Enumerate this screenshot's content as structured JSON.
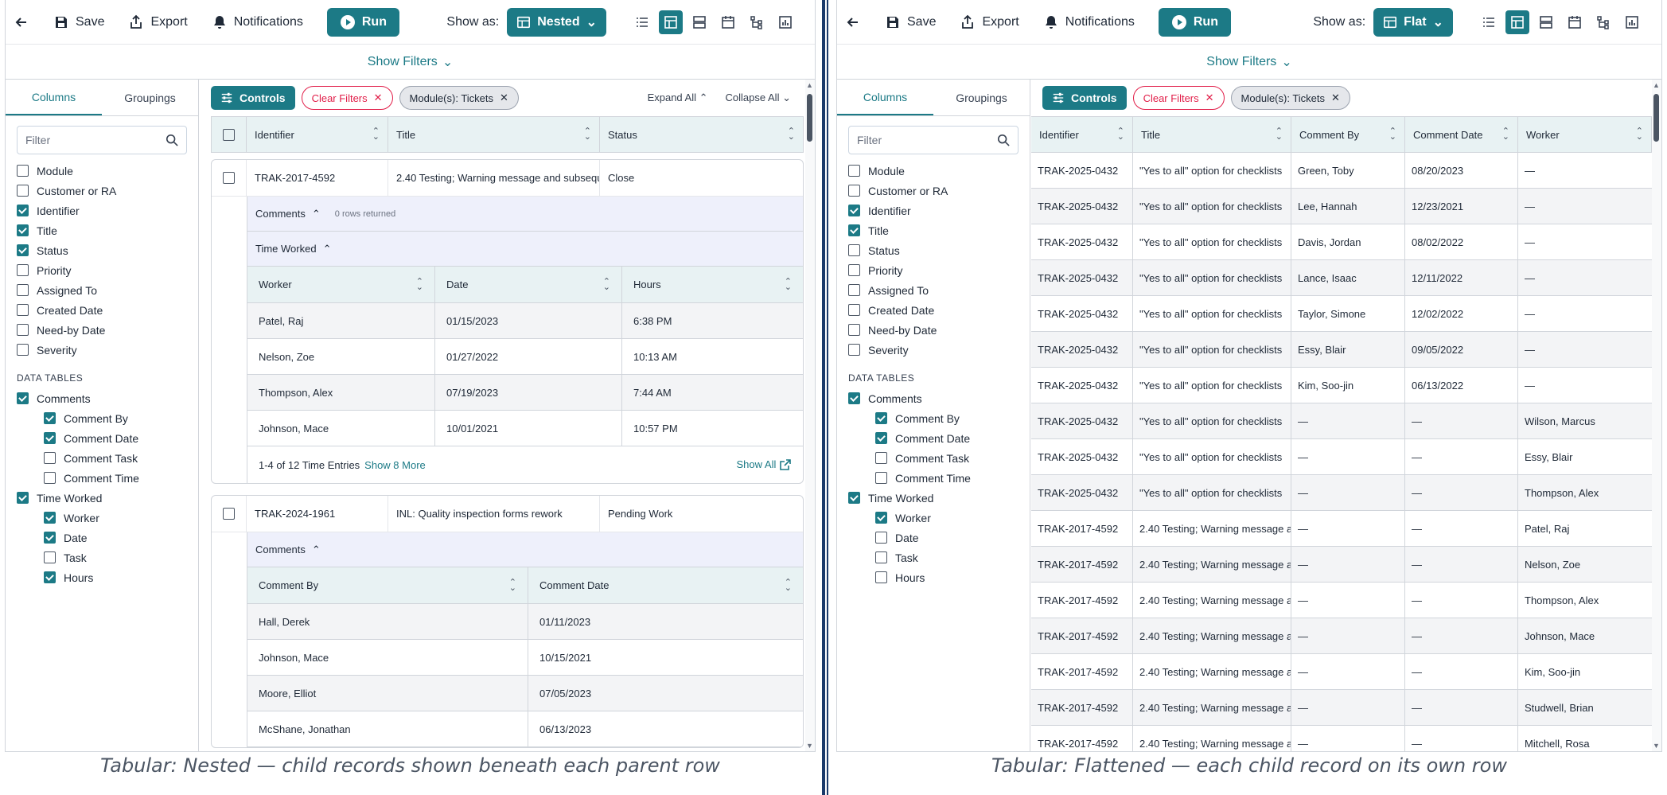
{
  "toolbar": {
    "save": "Save",
    "export": "Export",
    "notifications": "Notifications",
    "run": "Run",
    "show_as_label": "Show as:"
  },
  "show_filters": "Show Filters",
  "side": {
    "tab_columns": "Columns",
    "tab_groupings": "Groupings",
    "filter_placeholder": "Filter",
    "data_tables_heading": "DATA TABLES"
  },
  "controls": {
    "controls_btn": "Controls",
    "clear_filters": "Clear Filters",
    "module_chip": "Module(s): Tickets",
    "expand_all": "Expand All",
    "collapse_all": "Collapse All"
  },
  "left": {
    "show_as_value": "Nested",
    "caption": "Tabular: Nested — child records shown beneath each parent row",
    "columns": [
      {
        "label": "Module",
        "checked": false
      },
      {
        "label": "Customer or RA",
        "checked": false
      },
      {
        "label": "Identifier",
        "checked": true
      },
      {
        "label": "Title",
        "checked": true
      },
      {
        "label": "Status",
        "checked": true
      },
      {
        "label": "Priority",
        "checked": false
      },
      {
        "label": "Assigned To",
        "checked": false
      },
      {
        "label": "Created Date",
        "checked": false
      },
      {
        "label": "Need-by Date",
        "checked": false
      },
      {
        "label": "Severity",
        "checked": false
      }
    ],
    "data_tables": {
      "comments": {
        "label": "Comments",
        "checked": true,
        "children": [
          {
            "label": "Comment By",
            "checked": true
          },
          {
            "label": "Comment Date",
            "checked": true
          },
          {
            "label": "Comment Task",
            "checked": false
          },
          {
            "label": "Comment Time",
            "checked": false
          }
        ]
      },
      "time_worked": {
        "label": "Time Worked",
        "checked": true,
        "children": [
          {
            "label": "Worker",
            "checked": true
          },
          {
            "label": "Date",
            "checked": true
          },
          {
            "label": "Task",
            "checked": false
          },
          {
            "label": "Hours",
            "checked": true
          }
        ]
      }
    },
    "table_headers": [
      "Identifier",
      "Title",
      "Status"
    ],
    "cards": [
      {
        "identifier": "TRAK-2017-4592",
        "title": "2.40 Testing; Warning message and subsequ",
        "status": "Close",
        "comments_label": "Comments",
        "comments_note": "0 rows returned",
        "time_label": "Time Worked",
        "time_headers": [
          "Worker",
          "Date",
          "Hours"
        ],
        "time_rows": [
          [
            "Patel, Raj",
            "01/15/2023",
            "6:38 PM"
          ],
          [
            "Nelson, Zoe",
            "01/27/2022",
            "10:13 AM"
          ],
          [
            "Thompson, Alex",
            "07/19/2023",
            "7:44 AM"
          ],
          [
            "Johnson, Mace",
            "10/01/2021",
            "10:57 PM"
          ]
        ],
        "footer_count": "1-4 of 12 Time Entries",
        "footer_more": "Show 8 More",
        "footer_all": "Show All"
      },
      {
        "identifier": "TRAK-2024-1961",
        "title": "INL: Quality inspection forms rework",
        "status": "Pending Work",
        "comments_label": "Comments",
        "comment_headers": [
          "Comment By",
          "Comment Date"
        ],
        "comment_rows": [
          [
            "Hall, Derek",
            "01/11/2023"
          ],
          [
            "Johnson, Mace",
            "10/15/2021"
          ],
          [
            "Moore, Elliot",
            "07/05/2023"
          ],
          [
            "McShane, Jonathan",
            "06/13/2023"
          ]
        ]
      }
    ]
  },
  "right": {
    "show_as_value": "Flat",
    "caption": "Tabular: Flattened — each child record on its own row",
    "columns": [
      {
        "label": "Module",
        "checked": false
      },
      {
        "label": "Customer or RA",
        "checked": false
      },
      {
        "label": "Identifier",
        "checked": true
      },
      {
        "label": "Title",
        "checked": true
      },
      {
        "label": "Status",
        "checked": false
      },
      {
        "label": "Priority",
        "checked": false
      },
      {
        "label": "Assigned To",
        "checked": false
      },
      {
        "label": "Created Date",
        "checked": false
      },
      {
        "label": "Need-by Date",
        "checked": false
      },
      {
        "label": "Severity",
        "checked": false
      }
    ],
    "data_tables": {
      "comments": {
        "label": "Comments",
        "checked": true,
        "children": [
          {
            "label": "Comment By",
            "checked": true
          },
          {
            "label": "Comment Date",
            "checked": true
          },
          {
            "label": "Comment Task",
            "checked": false
          },
          {
            "label": "Comment Time",
            "checked": false
          }
        ]
      },
      "time_worked": {
        "label": "Time Worked",
        "checked": true,
        "children": [
          {
            "label": "Worker",
            "checked": true
          },
          {
            "label": "Date",
            "checked": false
          },
          {
            "label": "Task",
            "checked": false
          },
          {
            "label": "Hours",
            "checked": false
          }
        ]
      }
    },
    "table_headers": [
      "Identifier",
      "Title",
      "Comment By",
      "Comment Date",
      "Worker"
    ],
    "rows": [
      [
        "TRAK-2025-0432",
        "\"Yes to all\" option for checklists",
        "Green, Toby",
        "08/20/2023",
        "—"
      ],
      [
        "TRAK-2025-0432",
        "\"Yes to all\" option for checklists",
        "Lee, Hannah",
        "12/23/2021",
        "—"
      ],
      [
        "TRAK-2025-0432",
        "\"Yes to all\" option for checklists",
        "Davis, Jordan",
        "08/02/2022",
        "—"
      ],
      [
        "TRAK-2025-0432",
        "\"Yes to all\" option for checklists",
        "Lance, Isaac",
        "12/11/2022",
        "—"
      ],
      [
        "TRAK-2025-0432",
        "\"Yes to all\" option for checklists",
        "Taylor, Simone",
        "12/02/2022",
        "—"
      ],
      [
        "TRAK-2025-0432",
        "\"Yes to all\" option for checklists",
        "Essy, Blair",
        "09/05/2022",
        "—"
      ],
      [
        "TRAK-2025-0432",
        "\"Yes to all\" option for checklists",
        "Kim, Soo-jin",
        "06/13/2022",
        "—"
      ],
      [
        "TRAK-2025-0432",
        "\"Yes to all\" option for checklists",
        "—",
        "—",
        "Wilson, Marcus"
      ],
      [
        "TRAK-2025-0432",
        "\"Yes to all\" option for checklists",
        "—",
        "—",
        "Essy, Blair"
      ],
      [
        "TRAK-2025-0432",
        "\"Yes to all\" option for checklists",
        "—",
        "—",
        "Thompson, Alex"
      ],
      [
        "TRAK-2017-4592",
        "2.40 Testing; Warning message a",
        "—",
        "—",
        "Patel, Raj"
      ],
      [
        "TRAK-2017-4592",
        "2.40 Testing; Warning message a",
        "—",
        "—",
        "Nelson, Zoe"
      ],
      [
        "TRAK-2017-4592",
        "2.40 Testing; Warning message a",
        "—",
        "—",
        "Thompson, Alex"
      ],
      [
        "TRAK-2017-4592",
        "2.40 Testing; Warning message a",
        "—",
        "—",
        "Johnson, Mace"
      ],
      [
        "TRAK-2017-4592",
        "2.40 Testing; Warning message a",
        "—",
        "—",
        "Kim, Soo-jin"
      ],
      [
        "TRAK-2017-4592",
        "2.40 Testing; Warning message a",
        "—",
        "—",
        "Studwell, Brian"
      ],
      [
        "TRAK-2017-4592",
        "2.40 Testing; Warning message a",
        "—",
        "—",
        "Mitchell, Rosa"
      ]
    ]
  },
  "colors": {
    "accent": "#1c7a86",
    "danger": "#e11d48",
    "header_bg": "#e8f2f3",
    "sub_bg": "#eef0fb",
    "divider": "#1b3a6b"
  },
  "icons": [
    "back-arrow-icon",
    "save-icon",
    "export-icon",
    "bell-icon",
    "play-icon",
    "table-icon",
    "chevron-down-icon",
    "list-view-icon",
    "grid-view-icon",
    "rows-view-icon",
    "calendar-view-icon",
    "tree-view-icon",
    "chart-view-icon",
    "search-icon",
    "sliders-icon",
    "close-icon",
    "chevron-up-icon",
    "sort-icon",
    "external-link-icon"
  ]
}
